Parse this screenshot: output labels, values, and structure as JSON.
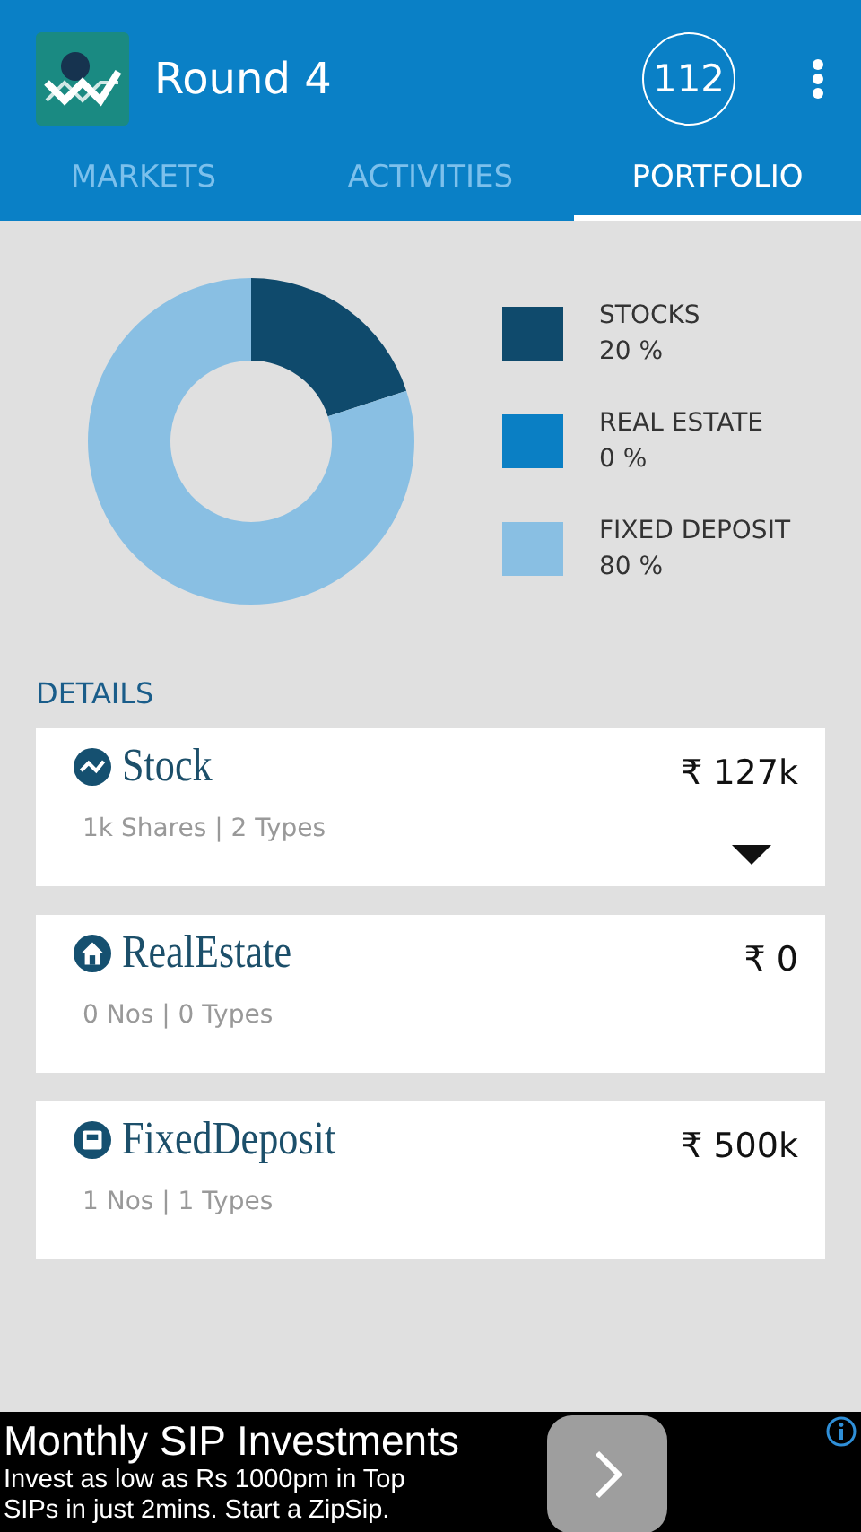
{
  "app_bar": {
    "title": "Round 4",
    "badge": "112"
  },
  "tabs": [
    {
      "label": "MARKETS",
      "selected": false
    },
    {
      "label": "ACTIVITIES",
      "selected": false
    },
    {
      "label": "PORTFOLIO",
      "selected": true
    }
  ],
  "legend": [
    {
      "value": "20 %",
      "color": "#0f4a6c"
    },
    {
      "value": "0 %",
      "color": "#0a7fc4"
    },
    {
      "value": "80 %",
      "color": "#89bfe3"
    }
  ],
  "chart_data": {
    "type": "donut",
    "categories": [
      "STOCKS",
      "REAL ESTATE",
      "FIXED DEPOSIT"
    ],
    "values": [
      20,
      0,
      80
    ]
  },
  "details": {
    "heading": "DETAILS",
    "cards": [
      {
        "kind": "stock",
        "title": "Stock",
        "amount": "₹ 127k",
        "summary": "1k Shares | 2 Types",
        "expandable": true
      },
      {
        "kind": "real_estate",
        "title": "RealEstate",
        "amount": "₹ 0",
        "summary": "0 Nos | 0 Types",
        "expandable": false
      },
      {
        "kind": "fixed_deposit",
        "title": "FixedDeposit",
        "amount": "₹ 500k",
        "summary": "1 Nos | 1 Types",
        "expandable": false
      }
    ]
  },
  "ad": {
    "title": "Monthly SIP Investments",
    "text": "Invest as low as Rs 1000pm in Top SIPs in just 2mins. Start a ZipSip."
  }
}
